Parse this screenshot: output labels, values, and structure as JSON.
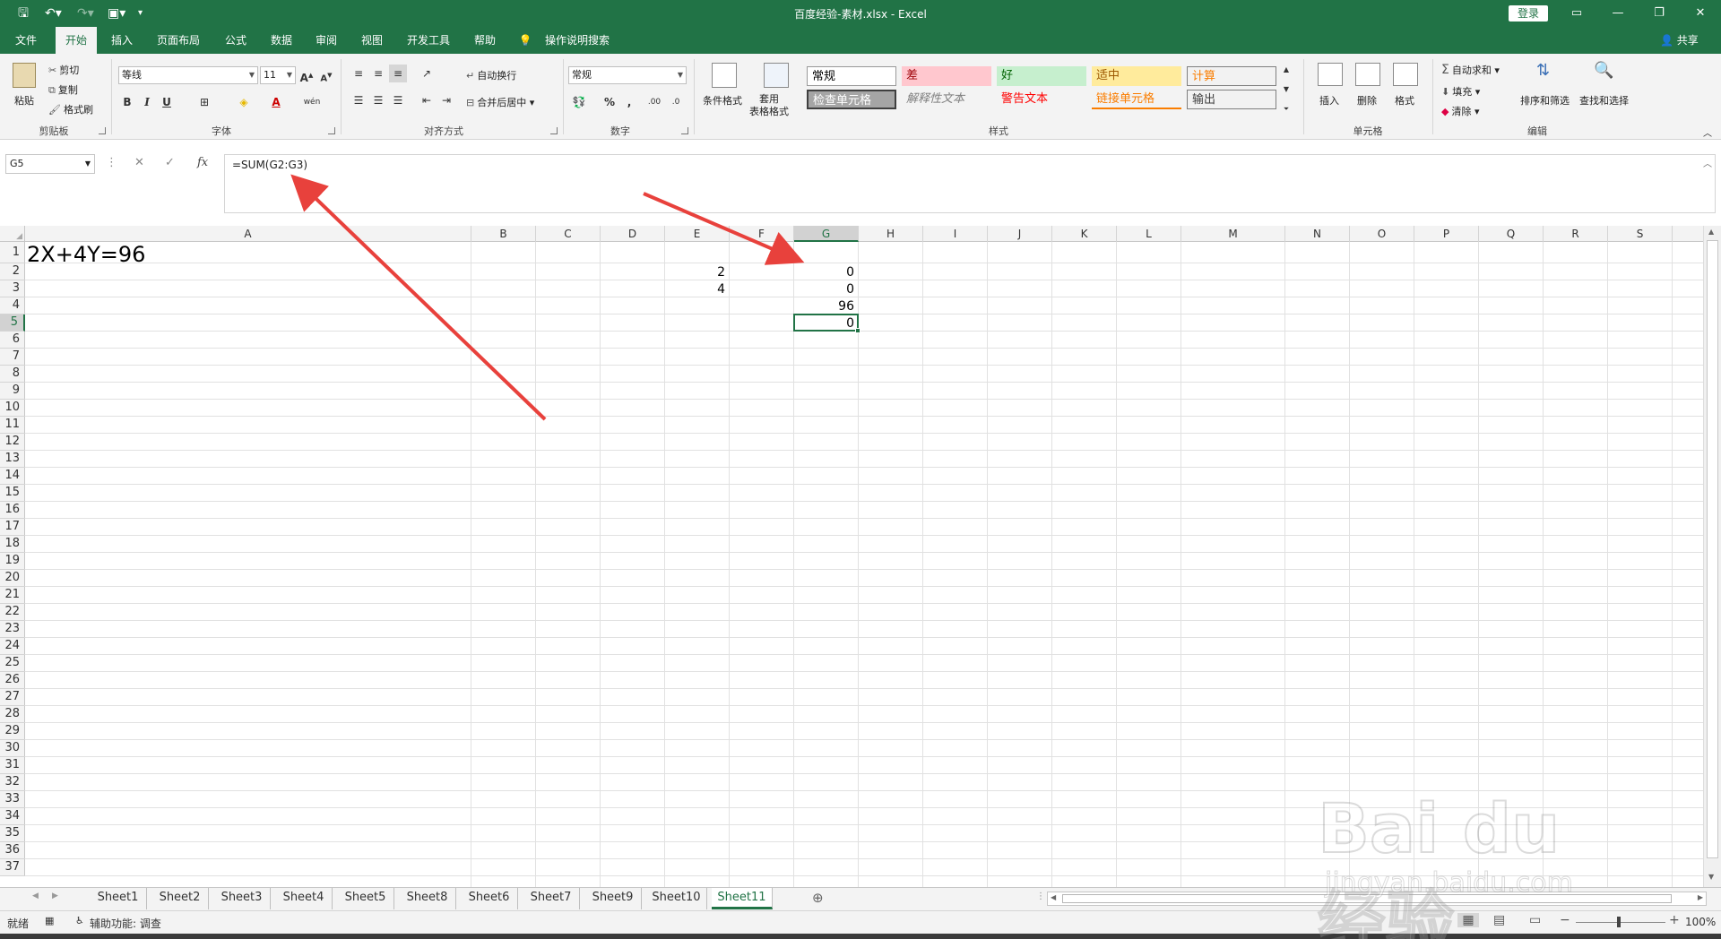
{
  "window": {
    "title": "百度经验-素材.xlsx  -  Excel",
    "login_label": "登录",
    "share_label": "共享"
  },
  "tabs": [
    "文件",
    "开始",
    "插入",
    "页面布局",
    "公式",
    "数据",
    "审阅",
    "视图",
    "开发工具",
    "帮助",
    "操作说明搜索"
  ],
  "active_tab": "开始",
  "ribbon": {
    "clipboard": {
      "paste": "粘贴",
      "cut": "剪切",
      "copy": "复制",
      "format_painter": "格式刷",
      "label": "剪贴板"
    },
    "font": {
      "name": "等线",
      "size": "11",
      "label": "字体",
      "bold": "B",
      "italic": "I",
      "underline": "U"
    },
    "alignment": {
      "wrap": "自动换行",
      "merge": "合并后居中",
      "label": "对齐方式"
    },
    "number": {
      "format": "常规",
      "percent": "%",
      "label": "数字"
    },
    "styles": {
      "conditional": "条件格式",
      "table": "套用\n表格格式",
      "label": "样式",
      "cells": [
        {
          "text": "常规",
          "bg": "#ffffff",
          "color": "#000000"
        },
        {
          "text": "差",
          "bg": "#ffc7ce",
          "color": "#9c0006"
        },
        {
          "text": "好",
          "bg": "#c6efce",
          "color": "#006100"
        },
        {
          "text": "适中",
          "bg": "#ffeb9c",
          "color": "#9c5700"
        },
        {
          "text": "计算",
          "bg": "#f2f2f2",
          "color": "#fa7d00"
        },
        {
          "text": "检查单元格",
          "bg": "#a5a5a5",
          "color": "#ffffff"
        },
        {
          "text": "解释性文本",
          "bg": "#f3f3f3",
          "color": "#7f7f7f"
        },
        {
          "text": "警告文本",
          "bg": "#f3f3f3",
          "color": "#ff0000"
        },
        {
          "text": "链接单元格",
          "bg": "#f3f3f3",
          "color": "#fa7d00"
        },
        {
          "text": "输出",
          "bg": "#f2f2f2",
          "color": "#3f3f3f"
        }
      ]
    },
    "cells": {
      "insert": "插入",
      "delete": "删除",
      "format": "格式",
      "label": "单元格"
    },
    "editing": {
      "autosum": "自动求和",
      "fill": "填充",
      "clear": "清除",
      "sort": "排序和筛选",
      "find": "查找和选择",
      "label": "编辑"
    }
  },
  "formula_bar": {
    "name_box": "G5",
    "formula": "=SUM(G2:G3)",
    "fx": "fx"
  },
  "columns": [
    "A",
    "B",
    "C",
    "D",
    "E",
    "F",
    "G",
    "H",
    "I",
    "J",
    "K",
    "L",
    "M",
    "N",
    "O",
    "P",
    "Q",
    "R",
    "S"
  ],
  "rows": [
    "1",
    "2",
    "3",
    "4",
    "5",
    "6",
    "7",
    "8",
    "9",
    "10",
    "11",
    "12",
    "13",
    "14",
    "15",
    "16",
    "17",
    "18",
    "19",
    "20",
    "21",
    "22",
    "23",
    "24",
    "25",
    "26",
    "27",
    "28",
    "29",
    "30",
    "31",
    "32",
    "33",
    "34",
    "35",
    "36",
    "37"
  ],
  "cells": {
    "A1": "2X+4Y=96",
    "E2": "2",
    "E3": "4",
    "G2": "0",
    "G3": "0",
    "G4": "96",
    "G5": "0"
  },
  "sheets": [
    "Sheet1",
    "Sheet2",
    "Sheet3",
    "Sheet4",
    "Sheet5",
    "Sheet8",
    "Sheet6",
    "Sheet7",
    "Sheet9",
    "Sheet10",
    "Sheet11"
  ],
  "active_sheet": "Sheet11",
  "status": {
    "ready": "就绪",
    "accessibility": "辅助功能: 调查",
    "zoom": "100%"
  },
  "watermark": {
    "main": "Bai du 经验",
    "sub": "jingyan.baidu.com"
  },
  "colors": {
    "accent": "#217346",
    "arrow": "#e8413c"
  }
}
